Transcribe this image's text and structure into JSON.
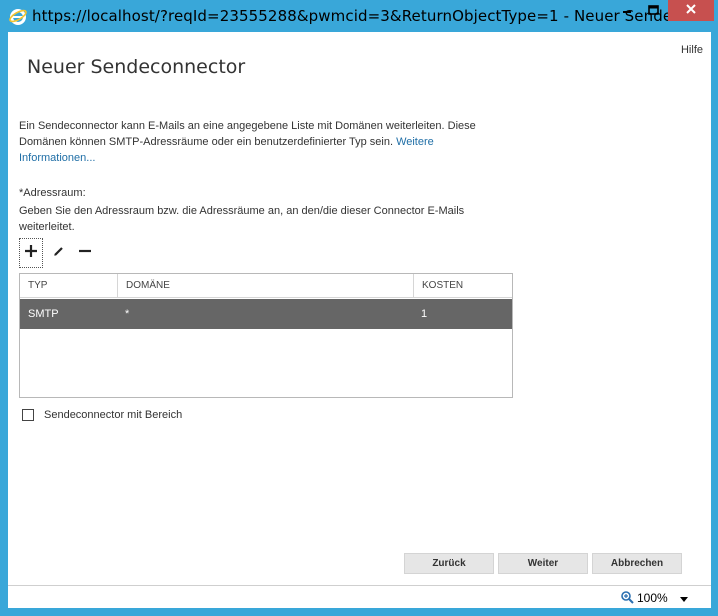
{
  "window": {
    "title": "https://localhost/?reqId=23555288&pwmcid=3&ReturnObjectType=1 - Neuer Sendeco..."
  },
  "help_label": "Hilfe",
  "page_title": "Neuer Sendeconnector",
  "description": {
    "text": "Ein Sendeconnector kann E-Mails an eine angegebene Liste mit Domänen weiterleiten. Diese Domänen können SMTP-Adressräume oder ein benutzerdefinierter Typ sein.",
    "link": "Weitere Informationen..."
  },
  "address_space": {
    "label": "*Adressraum:",
    "help": "Geben Sie den Adressraum bzw. die Adressräume an, an den/die dieser Connector E-Mails weiterleitet."
  },
  "toolbar": {
    "icons": [
      "add-icon",
      "edit-icon",
      "remove-icon"
    ]
  },
  "grid": {
    "columns": [
      "TYP",
      "DOMÄNE",
      "KOSTEN"
    ],
    "rows": [
      {
        "typ": "SMTP",
        "domain": "*",
        "kosten": "1"
      }
    ]
  },
  "scoped_checkbox": {
    "label": "Sendeconnector mit Bereich",
    "checked": false
  },
  "buttons": {
    "back": "Zurück",
    "next": "Weiter",
    "cancel": "Abbrechen"
  },
  "status": {
    "zoom": "100%"
  },
  "colors": {
    "chrome": "#39a7d9",
    "close_button": "#c7504f",
    "selected_row": "#666666",
    "link": "#1f6ea6"
  }
}
